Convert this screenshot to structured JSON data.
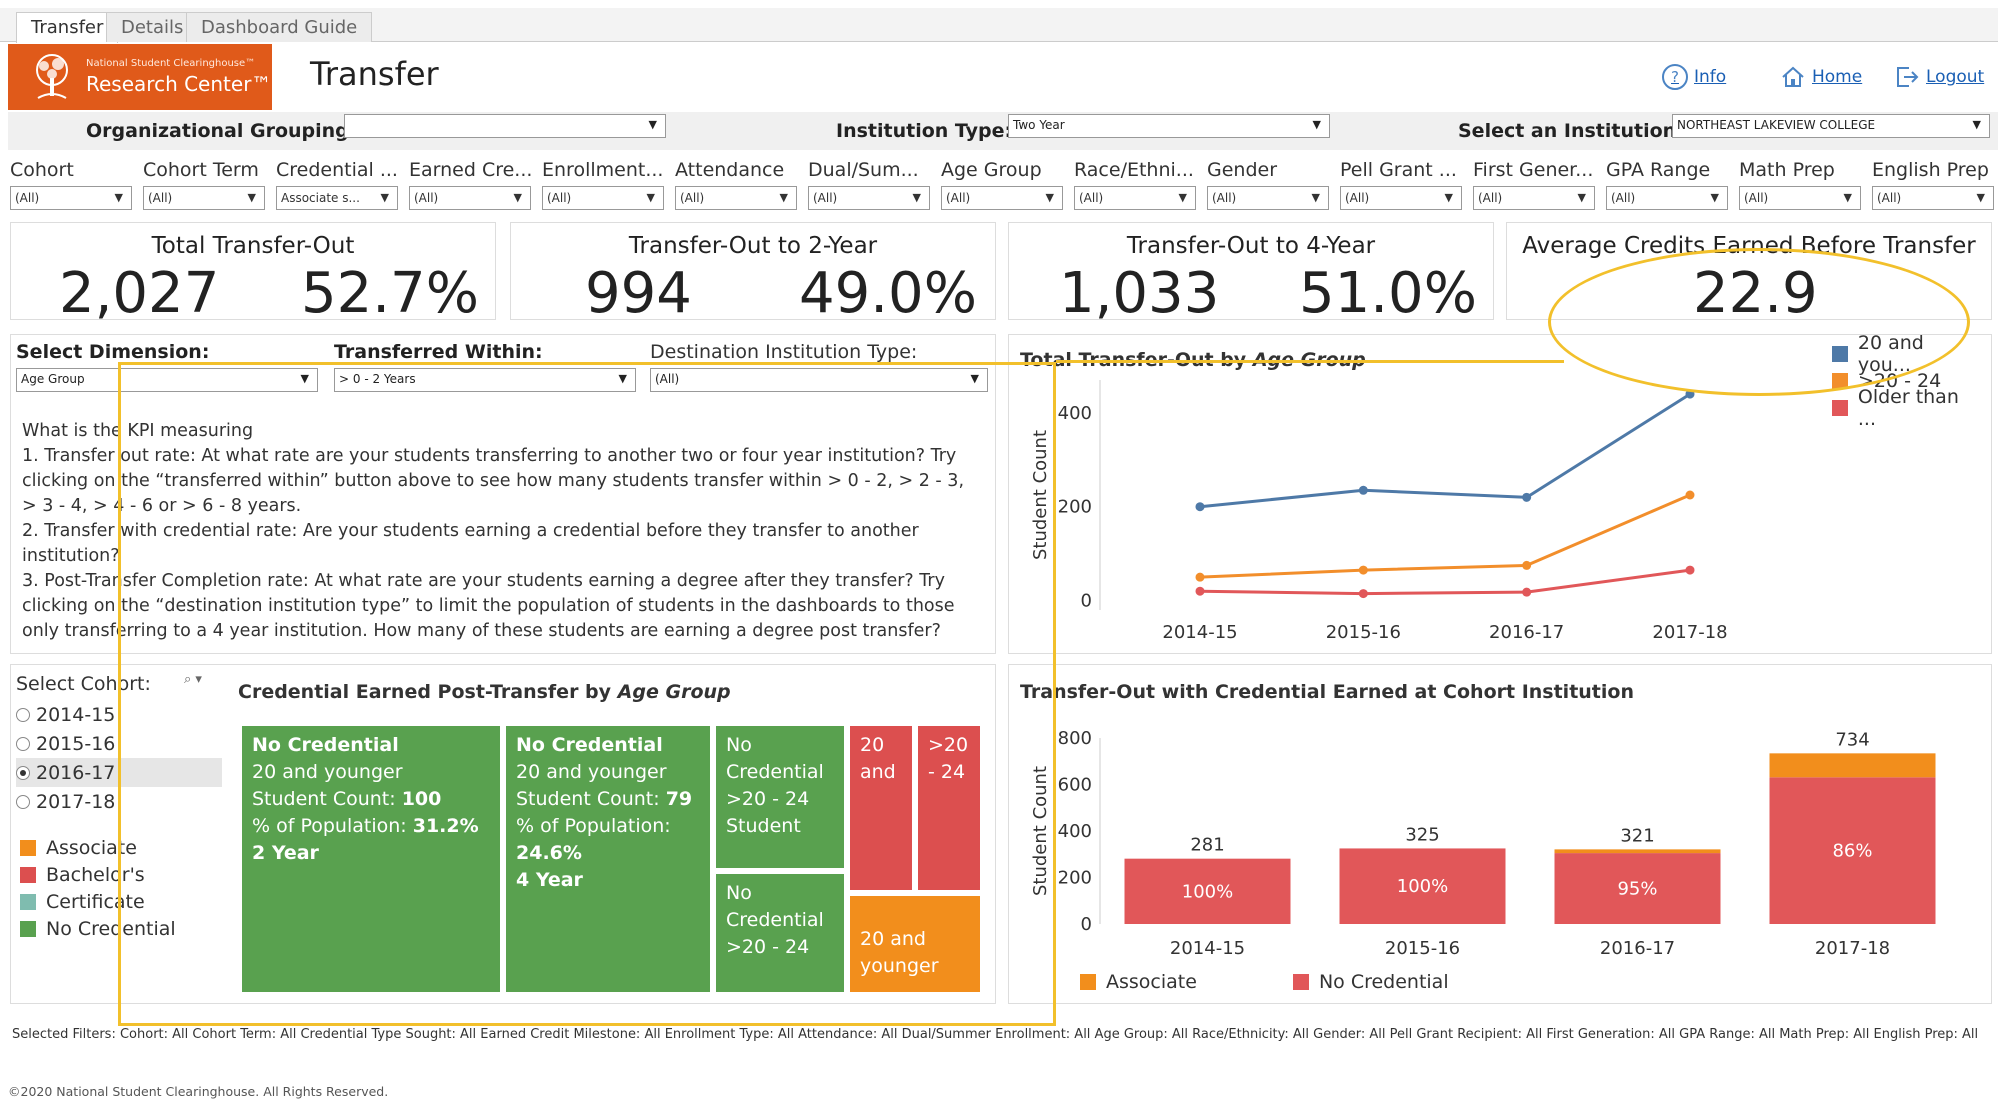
{
  "tabs": [
    "Transfer",
    "Details",
    "Dashboard Guide"
  ],
  "header": {
    "logo_small": "National Student Clearinghouse™",
    "logo_big": "Research Center™",
    "title": "Transfer",
    "links": {
      "info": "Info",
      "home": "Home",
      "logout": "Logout"
    }
  },
  "filters_top": {
    "org_label": "Organizational Grouping:",
    "org_value": "",
    "inst_type_label": "Institution Type:",
    "inst_type_value": "Two Year",
    "institution_label": "Select an Institution:",
    "institution_value": "NORTHEAST LAKEVIEW COLLEGE"
  },
  "filters_row": [
    {
      "label": "Cohort",
      "value": "(All)"
    },
    {
      "label": "Cohort Term",
      "value": "(All)"
    },
    {
      "label": "Credential ...",
      "value": "Associate s..."
    },
    {
      "label": "Earned Cre...",
      "value": "(All)"
    },
    {
      "label": "Enrollment...",
      "value": "(All)"
    },
    {
      "label": "Attendance",
      "value": "(All)"
    },
    {
      "label": "Dual/Sum...",
      "value": "(All)"
    },
    {
      "label": "Age Group",
      "value": "(All)"
    },
    {
      "label": "Race/Ethni...",
      "value": "(All)"
    },
    {
      "label": "Gender",
      "value": "(All)"
    },
    {
      "label": "Pell Grant ...",
      "value": "(All)"
    },
    {
      "label": "First Gener...",
      "value": "(All)"
    },
    {
      "label": "GPA Range",
      "value": "(All)"
    },
    {
      "label": "Math Prep",
      "value": "(All)"
    },
    {
      "label": "English Prep",
      "value": "(All)"
    }
  ],
  "kpis": {
    "total": {
      "title": "Total Transfer-Out",
      "count": "2,027",
      "pct": "52.7%"
    },
    "two_year": {
      "title": "Transfer-Out to 2-Year",
      "count": "994",
      "pct": "49.0%"
    },
    "four_year": {
      "title": "Transfer-Out to 4-Year",
      "count": "1,033",
      "pct": "51.0%"
    },
    "avg_credits": {
      "title": "Average Credits Earned Before Transfer",
      "value": "22.9"
    }
  },
  "controls": {
    "dimension_label": "Select Dimension:",
    "dimension_value": "Age Group",
    "within_label": "Transferred Within:",
    "within_value": "> 0 - 2 Years",
    "dest_label": "Destination Institution Type:",
    "dest_value": "(All)"
  },
  "kpi_text": {
    "heading": "What is the KPI measuring",
    "p1": "1. Transfer out rate: At what rate are your students transferring to another two or four year institution? Try clicking on the “transferred within” button above to see how many students transfer within > 0 - 2, > 2 - 3, > 3 - 4, > 4 - 6 or > 6 - 8 years.",
    "p2": "2. Transfer with credential rate: Are your students earning a credential before they transfer to another institution?",
    "p3": "3. Post-Transfer Completion rate: At what rate are your students earning a degree after they transfer? Try clicking on the “destination institution type” to limit the population of students in the dashboards to those only transferring to a 4 year institution. How many of these students are earning a degree post transfer?"
  },
  "cohort_select": {
    "label": "Select Cohort:",
    "options": [
      "2014-15",
      "2015-16",
      "2016-17",
      "2017-18"
    ],
    "selected": "2016-17"
  },
  "credential_legend": [
    {
      "label": "Associate",
      "color": "#f28e1c"
    },
    {
      "label": "Bachelor's",
      "color": "#dc4f4f"
    },
    {
      "label": "Certificate",
      "color": "#7fbcaf"
    },
    {
      "label": "No Credential",
      "color": "#59a14f"
    }
  ],
  "treemap": {
    "title_prefix": "Credential Earned Post-Transfer by ",
    "title_dim": "Age Group",
    "tiles": [
      {
        "lines": [
          "No Credential",
          "20 and younger",
          "Student Count: ",
          "100",
          "% of Population: ",
          "31.2%",
          "2 Year"
        ]
      },
      {
        "lines": [
          "No Credential",
          "20 and younger",
          "Student Count: ",
          "79",
          "% of Population:",
          "24.6%",
          "4 Year"
        ]
      },
      {
        "text": "No Credential >20 - 24 Student"
      },
      {
        "text": "No Credential >20 - 24"
      },
      {
        "text": "20 and"
      },
      {
        "text": ">20 - 24"
      },
      {
        "text": "20 and younger"
      }
    ]
  },
  "line_chart": {
    "title_prefix": "Total Transfer-Out by ",
    "title_dim": "Age Group",
    "legend": [
      "20 and you...",
      ">20 - 24",
      "Older than ..."
    ]
  },
  "bar_chart": {
    "title": "Transfer-Out with Credential Earned at Cohort Institution",
    "legend": [
      "Associate",
      "No Credential"
    ]
  },
  "chart_data": [
    {
      "type": "line",
      "title": "Total Transfer-Out by Age Group",
      "xlabel": "",
      "ylabel": "Student Count",
      "categories": [
        "2014-15",
        "2015-16",
        "2016-17",
        "2017-18"
      ],
      "ylim": [
        -20,
        470
      ],
      "yticks": [
        0,
        200,
        400
      ],
      "legend_position": "top-right",
      "series": [
        {
          "name": "20 and you...",
          "color": "#4e79a7",
          "values": [
            200,
            235,
            220,
            440
          ]
        },
        {
          "name": ">20 - 24",
          "color": "#f28e2b",
          "values": [
            50,
            65,
            75,
            225
          ]
        },
        {
          "name": "Older than ...",
          "color": "#e15759",
          "values": [
            20,
            15,
            18,
            65
          ]
        }
      ]
    },
    {
      "type": "bar",
      "title": "Transfer-Out with Credential Earned at Cohort Institution",
      "xlabel": "",
      "ylabel": "Student Count",
      "categories": [
        "2014-15",
        "2015-16",
        "2016-17",
        "2017-18"
      ],
      "ylim": [
        0,
        800
      ],
      "yticks": [
        0,
        200,
        400,
        600,
        800
      ],
      "legend_position": "bottom",
      "totals": [
        "281",
        "325",
        "321",
        "734"
      ],
      "pct_labels": [
        "100%",
        "100%",
        "95%",
        "86%"
      ],
      "series": [
        {
          "name": "No Credential",
          "color": "#e15759",
          "values": [
            281,
            325,
            305,
            631
          ]
        },
        {
          "name": "Associate",
          "color": "#f28e1c",
          "values": [
            0,
            0,
            16,
            103
          ]
        }
      ]
    }
  ],
  "footer": {
    "selected_filters": "Selected Filters:    Cohort: All    Cohort Term: All    Credential Type Sought: All    Earned Credit Milestone: All    Enrollment Type: All    Attendance: All    Dual/Summer Enrollment: All    Age Group: All    Race/Ethnicity: All    Gender: All    Pell Grant Recipient: All    First Generation: All    GPA Range: All    Math Prep: All    English Prep: All",
    "copyright": "©2020 National Student Clearinghouse. All Rights Reserved."
  }
}
